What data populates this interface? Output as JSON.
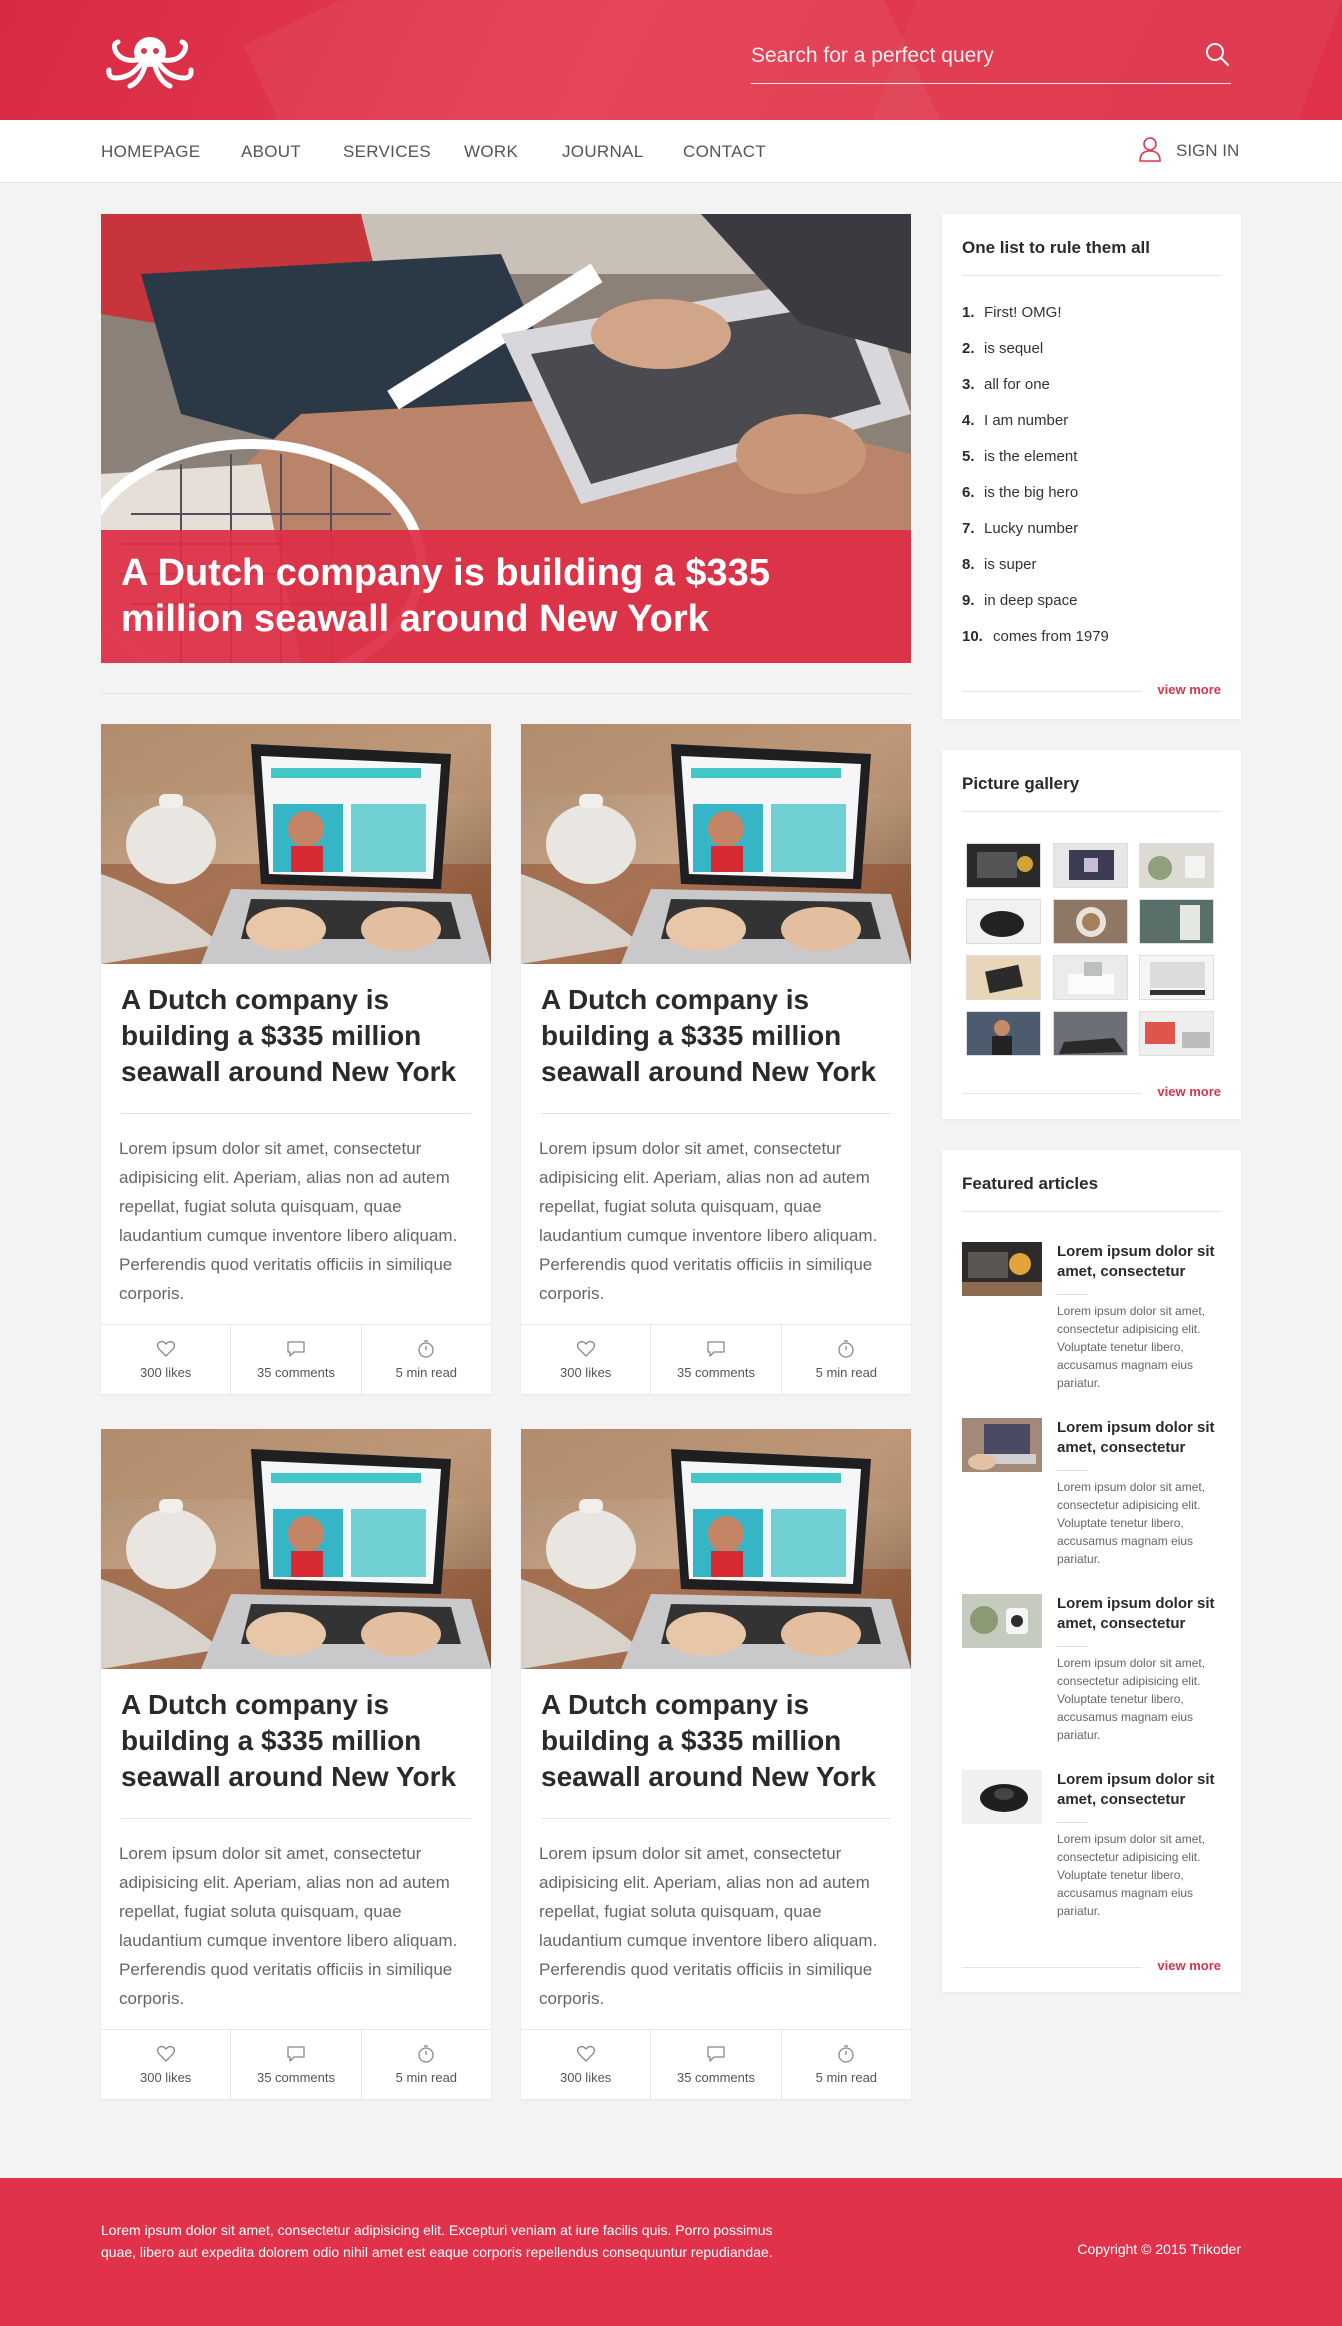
{
  "header": {
    "logo_name": "octopus-logo",
    "search_placeholder": "Search for a perfect query",
    "brand_color": "#e0364c"
  },
  "nav": {
    "items": [
      "HOMEPAGE",
      "ABOUT",
      "SERVICES",
      "WORK",
      "JOURNAL",
      "CONTACT"
    ],
    "signin_label": "SIGN IN"
  },
  "hero": {
    "title": "A Dutch company is building a $335 million seawall around New York"
  },
  "cards": [
    {
      "title": "A Dutch company is building a $335 million seawall around New York",
      "body": "Lorem ipsum dolor sit amet, consectetur adipisicing elit. Aperiam, alias non ad autem repellat, fugiat soluta quisquam, quae laudantium cumque inventore libero aliquam. Perferendis quod veritatis officiis in similique corporis.",
      "likes": "300 likes",
      "comments": "35 comments",
      "read": "5 min read"
    },
    {
      "title": "A Dutch company is building a $335 million seawall around New York",
      "body": "Lorem ipsum dolor sit amet, consectetur adipisicing elit. Aperiam, alias non ad autem repellat, fugiat soluta quisquam, quae laudantium cumque inventore libero aliquam. Perferendis quod veritatis officiis in similique corporis.",
      "likes": "300 likes",
      "comments": "35 comments",
      "read": "5 min read"
    },
    {
      "title": "A Dutch company is building a $335 million seawall around New York",
      "body": "Lorem ipsum dolor sit amet, consectetur adipisicing elit. Aperiam, alias non ad autem repellat, fugiat soluta quisquam, quae laudantium cumque inventore libero aliquam. Perferendis quod veritatis officiis in similique corporis.",
      "likes": "300 likes",
      "comments": "35 comments",
      "read": "5 min read"
    },
    {
      "title": "A Dutch company is building a $335 million seawall around New York",
      "body": "Lorem ipsum dolor sit amet, consectetur adipisicing elit. Aperiam, alias non ad autem repellat, fugiat soluta quisquam, quae laudantium cumque inventore libero aliquam. Perferendis quod veritatis officiis in similique corporis.",
      "likes": "300 likes",
      "comments": "35 comments",
      "read": "5 min read"
    }
  ],
  "sidebar": {
    "list_widget": {
      "title": "One list to rule them all",
      "items": [
        {
          "num": "1.",
          "text": "First! OMG!"
        },
        {
          "num": "2.",
          "text": "is sequel"
        },
        {
          "num": "3.",
          "text": "all for one"
        },
        {
          "num": "4.",
          "text": "I am number"
        },
        {
          "num": "5.",
          "text": "is the element"
        },
        {
          "num": "6.",
          "text": "is the big hero"
        },
        {
          "num": "7.",
          "text": "Lucky number"
        },
        {
          "num": "8.",
          "text": "is super"
        },
        {
          "num": "9.",
          "text": "in deep space"
        },
        {
          "num": "10.",
          "text": "comes from 1979"
        }
      ],
      "view_more": "view more"
    },
    "gallery_widget": {
      "title": "Picture gallery",
      "view_more": "view more"
    },
    "featured_widget": {
      "title": "Featured articles",
      "articles": [
        {
          "title": "Lorem ipsum dolor sit amet, consectetur",
          "body": "Lorem ipsum dolor sit amet, consectetur adipisicing elit. Voluptate tenetur libero, accusamus magnam eius pariatur."
        },
        {
          "title": "Lorem ipsum dolor sit amet, consectetur",
          "body": "Lorem ipsum dolor sit amet, consectetur adipisicing elit. Voluptate tenetur libero, accusamus magnam eius pariatur."
        },
        {
          "title": "Lorem ipsum dolor sit amet, consectetur",
          "body": "Lorem ipsum dolor sit amet, consectetur adipisicing elit. Voluptate tenetur libero, accusamus magnam eius pariatur."
        },
        {
          "title": "Lorem ipsum dolor sit amet, consectetur",
          "body": "Lorem ipsum dolor sit amet, consectetur adipisicing elit. Voluptate tenetur libero, accusamus magnam eius pariatur."
        }
      ],
      "view_more": "view more"
    }
  },
  "footer": {
    "text": "Lorem ipsum dolor sit amet, consectetur adipisicing elit. Excepturi veniam at iure facilis quis. Porro possimus quae, libero aut expedita dolorem odio nihil amet est eaque corporis repellendus consequuntur repudiandae.",
    "copyright": "Copyright © 2015 Trikoder"
  }
}
